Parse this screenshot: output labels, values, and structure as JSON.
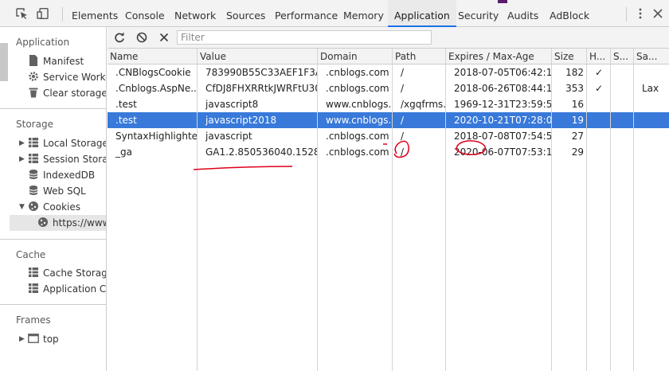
{
  "toolbar": {
    "tabs": [
      "Elements",
      "Console",
      "Network",
      "Sources",
      "Performance",
      "Memory",
      "Application",
      "Security",
      "Audits",
      "AdBlock"
    ],
    "active_tab": "Application"
  },
  "sidebar": {
    "application_title": "Application",
    "application_items": [
      "Manifest",
      "Service Workers",
      "Clear storage"
    ],
    "storage_title": "Storage",
    "storage_items": [
      "Local Storage",
      "Session Storage",
      "IndexedDB",
      "Web SQL",
      "Cookies"
    ],
    "cookie_child": "https://www.cnblogs.com",
    "cache_title": "Cache",
    "cache_items": [
      "Cache Storage",
      "Application Cache"
    ],
    "frames_title": "Frames",
    "frames_items": [
      "top"
    ]
  },
  "filter": {
    "placeholder": "Filter"
  },
  "table": {
    "headers": [
      "Name",
      "Value",
      "Domain",
      "Path",
      "Expires / Max-Age",
      "Size",
      "H...",
      "S...",
      "Sa..."
    ],
    "selected_row": 3,
    "rows": [
      [
        ".CNBlogsCookie",
        "783990B55C33AEF1F3AB...",
        ".cnblogs.com",
        "/",
        "2018-07-05T06:42:15....",
        "182",
        "✓",
        "",
        ""
      ],
      [
        ".Cnblogs.AspNe...",
        "CfDJ8FHXRRtkJWRFtU30...",
        ".cnblogs.com",
        "/",
        "2018-06-26T08:44:10....",
        "353",
        "✓",
        "",
        "Lax"
      ],
      [
        ".test",
        "javascript8",
        "www.cnblogs....",
        "/xgqfrms...",
        "1969-12-31T23:59:59....",
        "16",
        "",
        "",
        ""
      ],
      [
        ".test",
        "javascript2018",
        "www.cnblogs....",
        "/",
        "2020-10-21T07:28:00....",
        "19",
        "",
        "",
        ""
      ],
      [
        "SyntaxHighlighter",
        "javascript",
        ".cnblogs.com",
        "/",
        "2018-07-08T07:54:54....",
        "27",
        "",
        "",
        ""
      ],
      [
        "_ga",
        "GA1.2.850536040.15284...",
        ".cnblogs.com",
        "/",
        "2020-06-07T07:53:13....",
        "29",
        "",
        "",
        ""
      ]
    ]
  },
  "colors": {
    "selection": "#3879d9",
    "annotation": "#e0001a",
    "active_tab_underline": "#1a73e8"
  }
}
